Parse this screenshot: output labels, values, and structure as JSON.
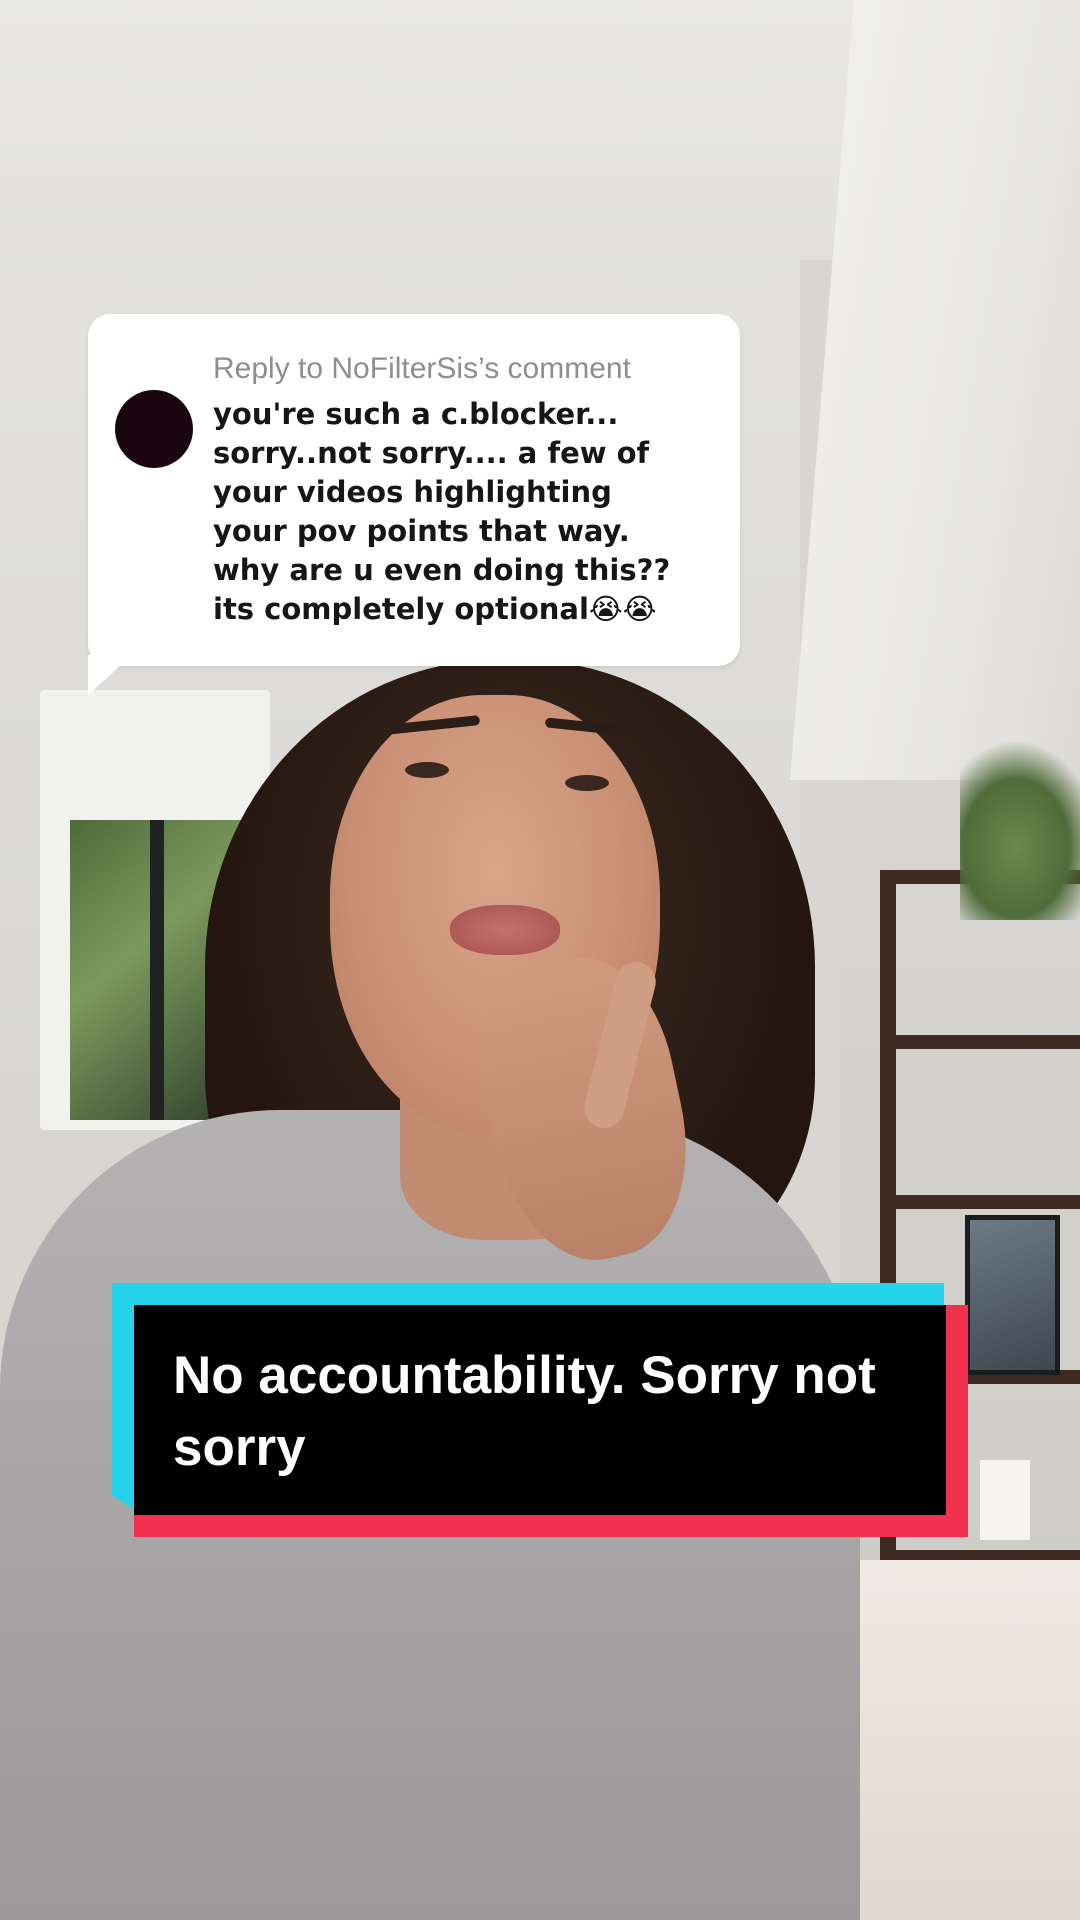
{
  "reply": {
    "header": "Reply to NoFilterSis’s comment",
    "comment": "you're such a c.blocker...\nsorry..not sorry.... a few of\nyour videos highlighting\nyour pov points that way.\nwhy are u even doing this??\nits completely optional😭😭"
  },
  "caption": {
    "text": "No accountability. Sorry not sorry"
  },
  "colors": {
    "caption_background": "#000000",
    "caption_shadow_cyan": "#25d3ea",
    "caption_shadow_red": "#f2304f",
    "bubble_background": "#ffffff",
    "avatar": "#1b0610"
  }
}
